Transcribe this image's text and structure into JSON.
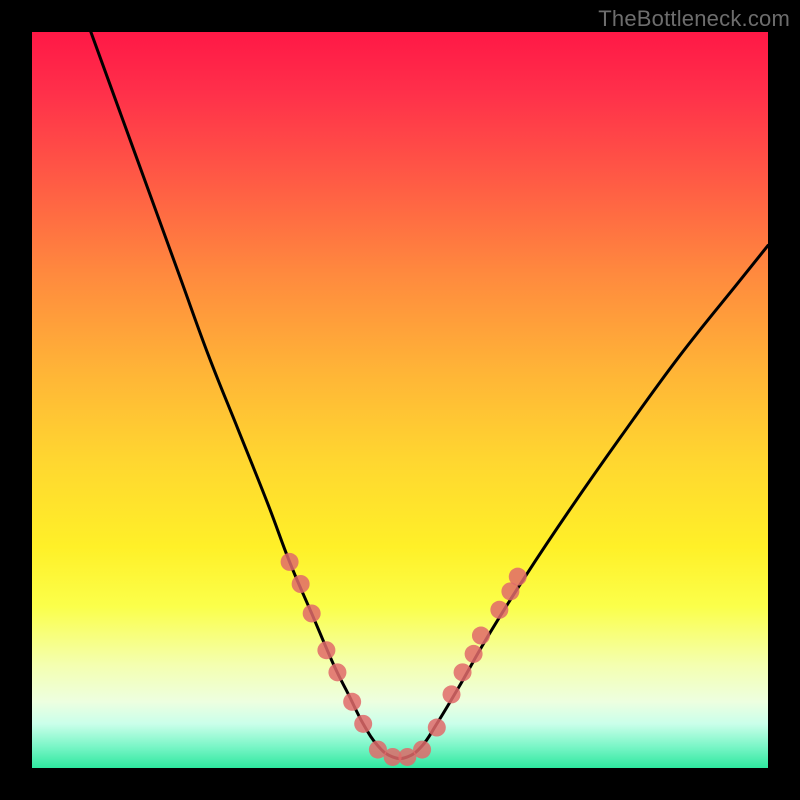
{
  "watermark": "TheBottleneck.com",
  "chart_data": {
    "type": "line",
    "title": "",
    "xlabel": "",
    "ylabel": "",
    "xlim": [
      0,
      100
    ],
    "ylim": [
      0,
      100
    ],
    "grid": false,
    "series": [
      {
        "name": "bottleneck-curve",
        "color": "#000000",
        "x": [
          8,
          12,
          16,
          20,
          24,
          28,
          32,
          35,
          38,
          41,
          43,
          45,
          47,
          49,
          51,
          53,
          55,
          58,
          62,
          67,
          73,
          80,
          88,
          96,
          100
        ],
        "y": [
          100,
          89,
          78,
          67,
          56,
          46,
          36,
          28,
          21,
          14,
          10,
          6,
          3,
          1.5,
          1.5,
          3,
          6,
          11,
          18,
          26,
          35,
          45,
          56,
          66,
          71
        ]
      }
    ],
    "markers": {
      "name": "highlighted-points",
      "color": "#e06a6a",
      "radius_px": 9,
      "points": [
        {
          "x": 35.0,
          "y": 28.0
        },
        {
          "x": 36.5,
          "y": 25.0
        },
        {
          "x": 38.0,
          "y": 21.0
        },
        {
          "x": 40.0,
          "y": 16.0
        },
        {
          "x": 41.5,
          "y": 13.0
        },
        {
          "x": 43.5,
          "y": 9.0
        },
        {
          "x": 45.0,
          "y": 6.0
        },
        {
          "x": 47.0,
          "y": 2.5
        },
        {
          "x": 49.0,
          "y": 1.5
        },
        {
          "x": 51.0,
          "y": 1.5
        },
        {
          "x": 53.0,
          "y": 2.5
        },
        {
          "x": 55.0,
          "y": 5.5
        },
        {
          "x": 57.0,
          "y": 10.0
        },
        {
          "x": 58.5,
          "y": 13.0
        },
        {
          "x": 60.0,
          "y": 15.5
        },
        {
          "x": 61.0,
          "y": 18.0
        },
        {
          "x": 63.5,
          "y": 21.5
        },
        {
          "x": 65.0,
          "y": 24.0
        },
        {
          "x": 66.0,
          "y": 26.0
        }
      ]
    }
  }
}
